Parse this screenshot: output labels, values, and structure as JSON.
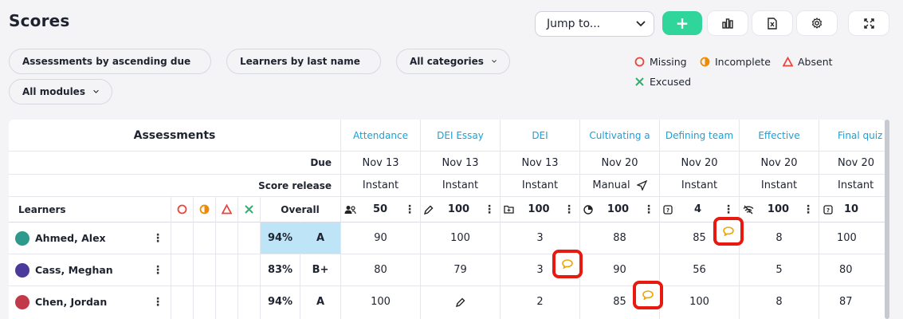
{
  "page": {
    "title": "Scores"
  },
  "toolbar": {
    "jump_label": "Jump to...",
    "add_label": "+"
  },
  "filters": {
    "assessments": "Assessments by ascending due",
    "learners": "Learners by last name",
    "categories": "All categories",
    "modules": "All modules"
  },
  "legend": {
    "missing": "Missing",
    "incomplete": "Incomplete",
    "absent": "Absent",
    "excused": "Excused"
  },
  "colors": {
    "accent_green": "#2fd59a",
    "link_blue": "#1aa0d8",
    "highlight": "#bde4f7",
    "flag_red": "#e8190f",
    "comment_orange": "#f0a400"
  },
  "table": {
    "assessments_header": "Assessments",
    "due_label": "Due",
    "release_label": "Score release",
    "learners_header": "Learners",
    "overall_header": "Overall",
    "columns": [
      {
        "name": "Attendance",
        "due": "Nov 13",
        "release": "Instant",
        "points": "50",
        "icon": "users-icon"
      },
      {
        "name": "DEI Essay",
        "due": "Nov 13",
        "release": "Instant",
        "points": "100",
        "icon": "pencil-icon"
      },
      {
        "name": "DEI",
        "due": "Nov 13",
        "release": "Instant",
        "points": "100",
        "icon": "folder-icon"
      },
      {
        "name": "Cultivating a",
        "due": "Nov 20",
        "release": "Manual",
        "points": "100",
        "icon": "pie-icon"
      },
      {
        "name": "Defining team",
        "due": "Nov 20",
        "release": "Instant",
        "points": "4",
        "icon": "quiz-icon"
      },
      {
        "name": "Effective",
        "due": "Nov 20",
        "release": "Instant",
        "points": "100",
        "icon": "wifi-off-icon"
      },
      {
        "name": "Final quiz",
        "due": "Nov 20",
        "release": "Instant",
        "points": "10",
        "icon": "quiz-icon"
      }
    ],
    "rows": [
      {
        "name": "Ahmed, Alex",
        "percent": "94%",
        "grade": "A",
        "scores": [
          "90",
          "100",
          "3",
          "88",
          "85",
          "8",
          "100"
        ]
      },
      {
        "name": "Cass, Meghan",
        "percent": "83%",
        "grade": "B+",
        "scores": [
          "80",
          "79",
          "3",
          "90",
          "56",
          "5",
          "80"
        ]
      },
      {
        "name": "Chen, Jordan",
        "percent": "94%",
        "grade": "A",
        "scores": [
          "100",
          "",
          "2",
          "85",
          "100",
          "8",
          "87"
        ]
      }
    ]
  }
}
